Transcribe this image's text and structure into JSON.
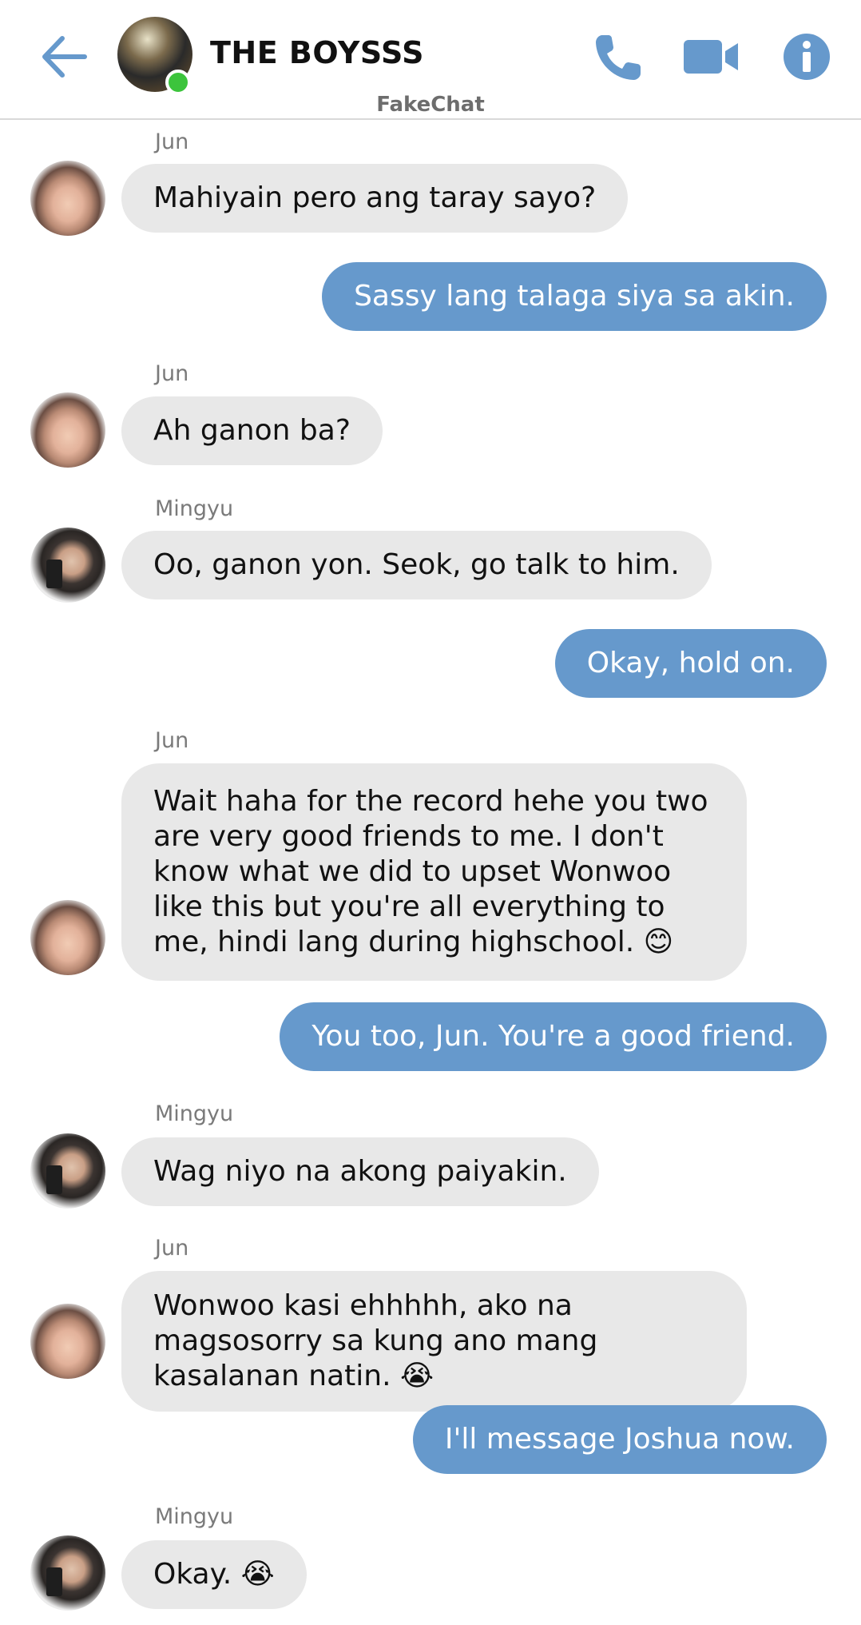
{
  "header": {
    "title": "THE BOYSSS",
    "app_label": "FakeChat",
    "back_icon": "back-arrow-icon",
    "call_icon": "phone-icon",
    "video_icon": "video-camera-icon",
    "info_icon": "info-icon"
  },
  "colors": {
    "accent": "#6699cc",
    "incoming_bubble": "#e8e8e8",
    "online": "#3cc43c"
  },
  "messages": [
    {
      "sender": "Jun",
      "text": "Mahiyain pero ang taray sayo?"
    },
    {
      "text": "Sassy lang talaga siya sa akin."
    },
    {
      "sender": "Jun",
      "text": "Ah ganon ba?"
    },
    {
      "sender": "Mingyu",
      "text": "Oo, ganon yon. Seok, go talk to him."
    },
    {
      "text": "Okay, hold on."
    },
    {
      "sender": "Jun",
      "text": "Wait haha for the record hehe you two are very good friends to me. I don't know what we did to upset Wonwoo like this but you're all everything to me, hindi lang during highschool. 😊"
    },
    {
      "text": "You too, Jun. You're a good friend."
    },
    {
      "sender": "Mingyu",
      "text": "Wag niyo na akong paiyakin."
    },
    {
      "sender": "Jun",
      "text": "Wonwoo kasi ehhhhh, ako na magsosorry sa kung ano mang kasalanan natin. 😭"
    },
    {
      "text": "I'll message Joshua now."
    },
    {
      "sender": "Mingyu",
      "text": "Okay. 😭"
    }
  ]
}
